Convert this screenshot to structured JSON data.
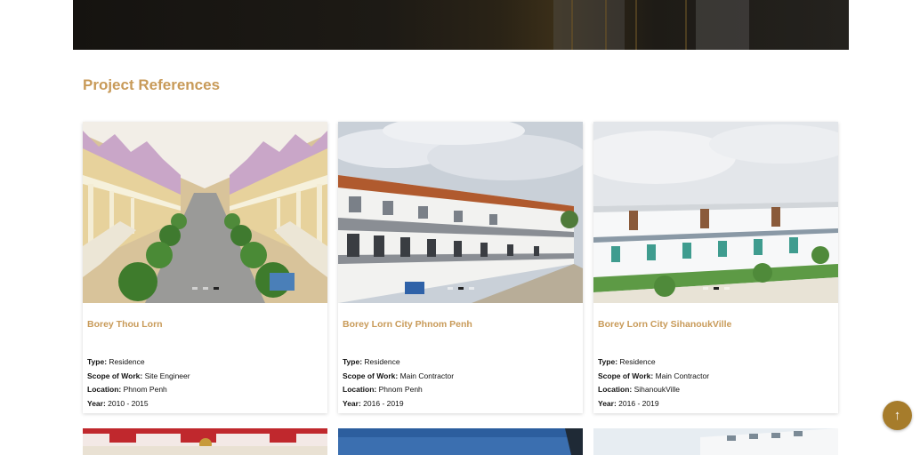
{
  "section": {
    "title": "Project References"
  },
  "projects": [
    {
      "name": "Borey Thou Lorn",
      "type_label": "Type:",
      "type": "Residence",
      "scope_label": "Scope of Work:",
      "scope": "Site Engineer",
      "location_label": "Location:",
      "location": "Phnom Penh",
      "year_label": "Year:",
      "year": "2010 - 2015"
    },
    {
      "name": "Borey Lorn City Phnom Penh",
      "type_label": "Type:",
      "type": "Residence",
      "scope_label": "Scope of Work:",
      "scope": "Main Contractor",
      "location_label": "Location:",
      "location": "Phnom Penh",
      "year_label": "Year:",
      "year": "2016 - 2019"
    },
    {
      "name": "Borey Lorn City SihanoukVille",
      "type_label": "Type:",
      "type": "Residence",
      "scope_label": "Scope of Work:",
      "scope": "Main Contractor",
      "location_label": "Location:",
      "location": "SihanoukVille",
      "year_label": "Year:",
      "year": "2016 - 2019"
    }
  ],
  "scroll_top": {
    "icon": "arrow-up-icon",
    "glyph": "↑"
  },
  "colors": {
    "accent": "#c89a58",
    "button": "#a67c2b"
  }
}
